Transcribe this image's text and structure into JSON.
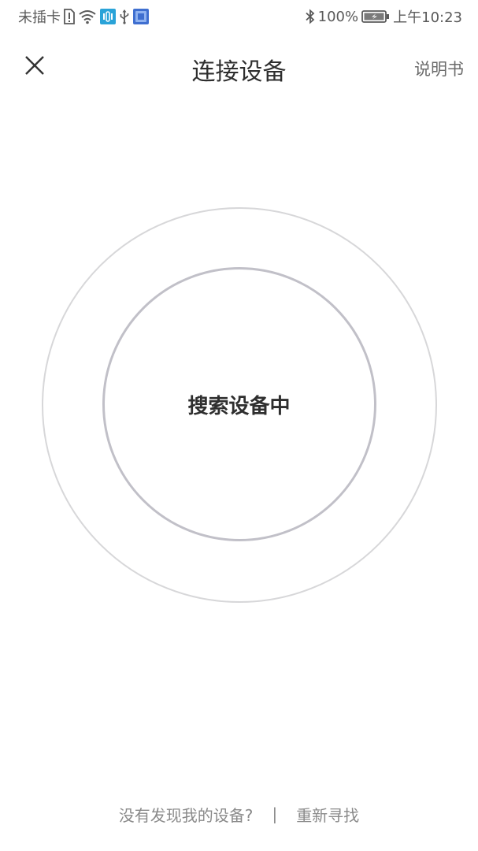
{
  "status_bar": {
    "carrier": "未插卡",
    "battery_percent": "100%",
    "time": "上午10:23",
    "icons_left": [
      "sim-alert-icon",
      "wifi-icon",
      "hd-voice-icon",
      "usb-icon",
      "app-notification-icon"
    ],
    "icons_right": [
      "bluetooth-icon",
      "battery-charging-icon"
    ]
  },
  "header": {
    "title": "连接设备",
    "manual_label": "说明书",
    "close_icon": "close-icon"
  },
  "search": {
    "status_text": "搜索设备中"
  },
  "footer": {
    "not_found_label": "没有发现我的设备?",
    "separator": "|",
    "retry_label": "重新寻找"
  },
  "colors": {
    "outer_ring": "#d7d7d9",
    "inner_ring": "#c1c0c8",
    "footer_text": "#8a8a8a",
    "hd_icon_bg": "#2aa3d8",
    "app_icon_bg": "#3f6fd0"
  }
}
